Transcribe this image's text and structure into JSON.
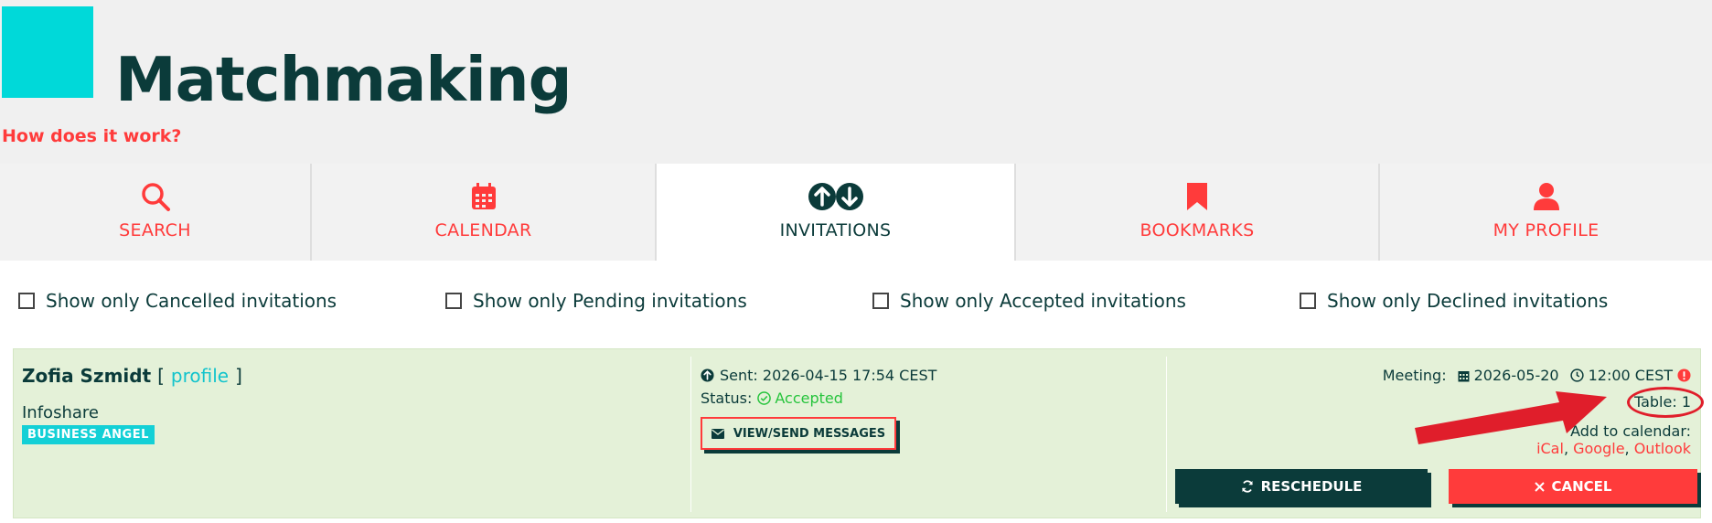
{
  "header": {
    "title": "Matchmaking",
    "help_link": "How does it work?"
  },
  "tabs": [
    {
      "label": "SEARCH",
      "icon": "search-icon"
    },
    {
      "label": "CALENDAR",
      "icon": "calendar-icon"
    },
    {
      "label": "INVITATIONS",
      "icon": "arrows-up-down-icon",
      "active": true
    },
    {
      "label": "BOOKMARKS",
      "icon": "bookmark-icon"
    },
    {
      "label": "MY PROFILE",
      "icon": "user-icon"
    }
  ],
  "filters": [
    "Show only Cancelled invitations",
    "Show only Pending invitations",
    "Show only Accepted invitations",
    "Show only Declined invitations"
  ],
  "invitation": {
    "name": "Zofia Szmidt",
    "open_bracket": "[",
    "profile_link": "profile",
    "close_bracket": "]",
    "organization": "Infoshare",
    "badge": "BUSINESS ANGEL",
    "sent": "Sent: 2026-04-15 17:54 CEST",
    "status_label": "Status:",
    "status_value": "Accepted",
    "messages_button": "VIEW/SEND MESSAGES",
    "meeting_label": "Meeting:",
    "meeting_date": "2026-05-20",
    "meeting_time": "12:00 CEST",
    "table": "Table: 1",
    "add_to_calendar": "Add to calendar:",
    "calendar_links": [
      "iCal",
      "Google",
      "Outlook"
    ],
    "reschedule_button": "RESCHEDULE",
    "cancel_button": "CANCEL"
  },
  "colors": {
    "accent": "#ff3b3b",
    "dark": "#0b3b3a",
    "teal": "#00d9d9",
    "card_bg": "#e4f1d8",
    "accepted": "#27c43d"
  }
}
